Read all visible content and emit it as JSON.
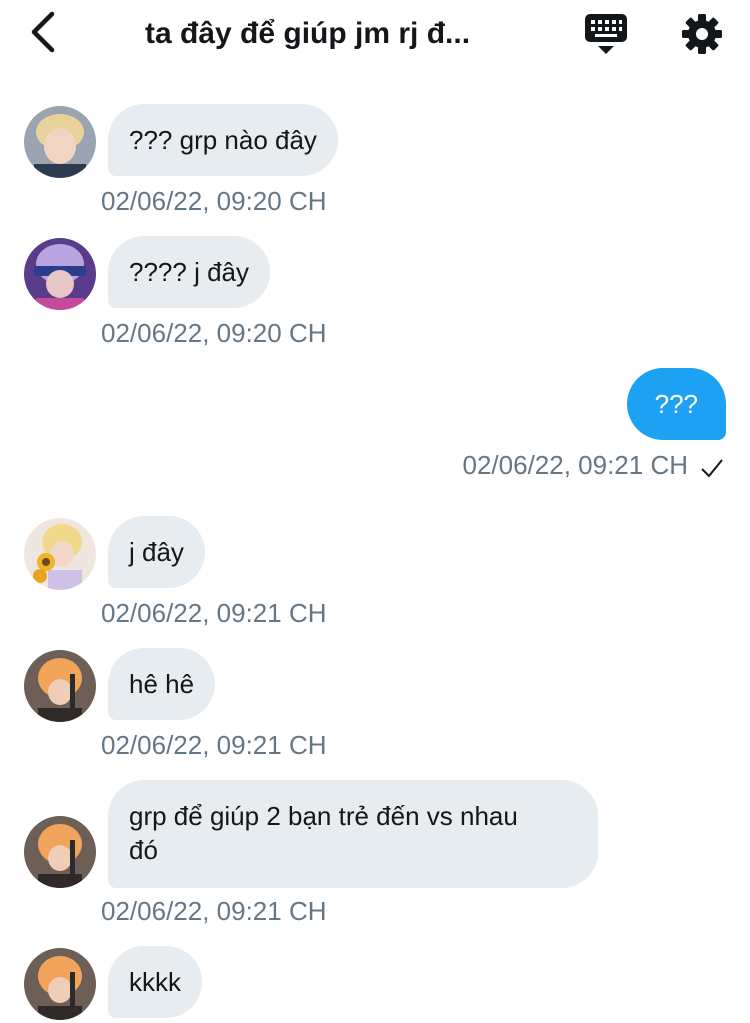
{
  "header": {
    "title": "ta đây để giúp jm rj đ...",
    "back_icon": "chevron-left-icon",
    "keyboard_icon": "keyboard-icon",
    "settings_icon": "gear-icon"
  },
  "messages": [
    {
      "text": "??? grp nào đây",
      "time": "02/06/22, 09:20 CH",
      "avatar": "avatar-photo-1"
    },
    {
      "text": "???? j đây",
      "time": "02/06/22, 09:20 CH",
      "avatar": "avatar-photo-2"
    },
    {
      "text": "???",
      "time": "02/06/22, 09:21 CH",
      "outgoing": true,
      "status_icon": "checkmark-icon"
    },
    {
      "text": "j đây",
      "time": "02/06/22, 09:21 CH",
      "avatar": "avatar-photo-3"
    },
    {
      "text": "hê hê",
      "time": "02/06/22, 09:21 CH",
      "avatar": "avatar-photo-4"
    },
    {
      "text": "grp để giúp 2 bạn trẻ đến vs nhau\nđó",
      "time": "02/06/22, 09:21 CH",
      "avatar": "avatar-photo-4"
    },
    {
      "text": "kkkk",
      "avatar": "avatar-photo-4"
    }
  ],
  "colors": {
    "incoming_bubble": "#e6ecf0",
    "outgoing_bubble": "#1da1f2",
    "timestamp": "#657786",
    "text": "#14171a"
  }
}
